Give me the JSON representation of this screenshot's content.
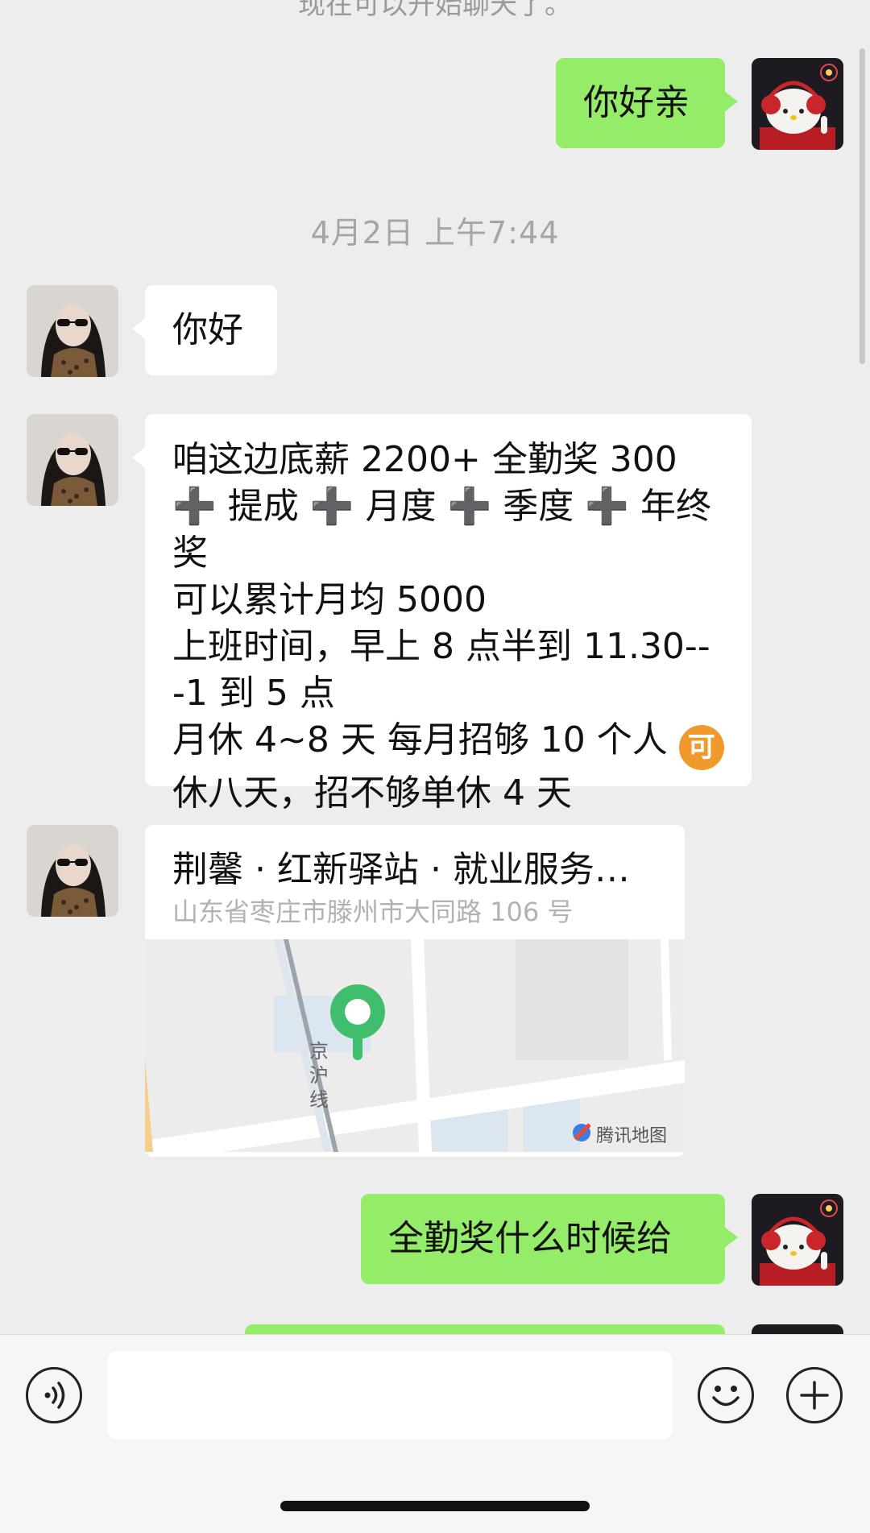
{
  "chat": {
    "system_note": "现在可以开始聊天了。",
    "timestamp": "4月2日 上午7:44",
    "messages": [
      {
        "text": "你好亲"
      },
      {
        "text": "你好"
      },
      {
        "line1": "咱这边底薪 2200+ 全勤奖 300",
        "line2": "➕ 提成 ➕ 月度 ➕ 季度 ➕ 年终奖",
        "line3": "可以累计月均 5000",
        "line4": "上班时间，早上 8 点半到 11.30--",
        "line5": "-1 到 5 点",
        "line6": "月休 4~8 天 每月招够 10 个人",
        "emoji": "可",
        "line7": "休八天，招不够单休 4 天"
      },
      {
        "text": "全勤奖什么时候给"
      }
    ],
    "location": {
      "title": "荆馨 · 红新驿站 · 就业服务…",
      "address": "山东省枣庄市滕州市大同路 106 号",
      "railway_label_1": "京",
      "railway_label_2": "沪",
      "railway_label_3": "线",
      "map_provider": "腾讯地图"
    }
  },
  "input_bar": {
    "placeholder": ""
  },
  "icons": {
    "voice": "voice-icon",
    "emoji": "emoji-icon",
    "plus": "plus-icon"
  },
  "colors": {
    "sent_bubble": "#95ec69",
    "received_bubble": "#ffffff",
    "background": "#ededed",
    "map_pin": "#3fbf6e"
  }
}
